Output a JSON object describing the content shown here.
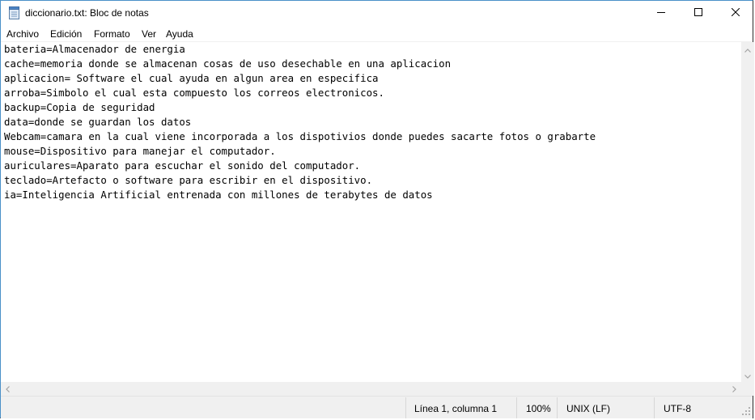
{
  "window": {
    "title": "diccionario.txt: Bloc de notas"
  },
  "icons": {
    "app": "notepad-icon",
    "minimize": "minimize-icon",
    "maximize": "maximize-icon",
    "close": "close-icon"
  },
  "menu": [
    "Archivo",
    "Edición",
    "Formato",
    "Ver",
    "Ayuda"
  ],
  "document": {
    "lines": [
      "bateria=Almacenador de energia",
      "cache=memoria donde se almacenan cosas de uso desechable en una aplicacion",
      "aplicacion= Software el cual ayuda en algun area en especifica",
      "arroba=Simbolo el cual esta compuesto los correos electronicos.",
      "backup=Copia de seguridad",
      "data=donde se guardan los datos",
      "Webcam=camara en la cual viene incorporada a los dispotivios donde puedes sacarte fotos o grabarte",
      "mouse=Dispositivo para manejar el computador.",
      "auriculares=Aparato para escuchar el sonido del computador.",
      "teclado=Artefacto o software para escribir en el dispositivo.",
      "ia=Inteligencia Artificial entrenada con millones de terabytes de datos"
    ]
  },
  "status": {
    "position": "Línea 1, columna 1",
    "zoom": "100%",
    "line_ending": "UNIX (LF)",
    "encoding": "UTF-8"
  }
}
